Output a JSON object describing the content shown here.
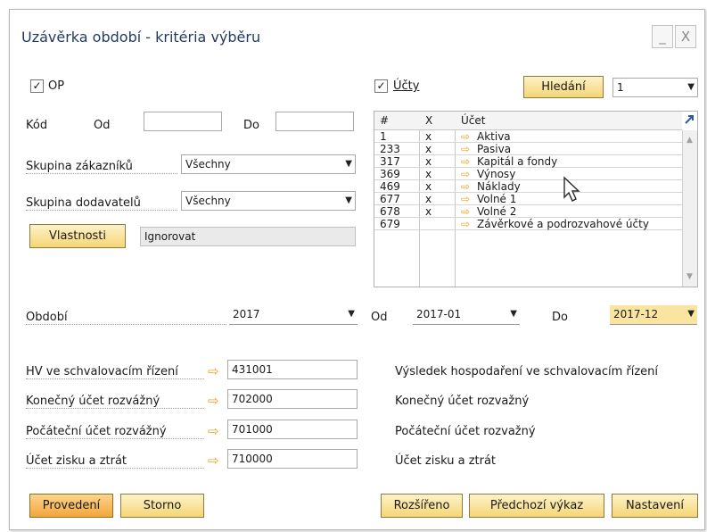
{
  "window": {
    "title": "Uzávěrka období - kritéria výběru",
    "min_glyph": "_",
    "close_glyph": "X"
  },
  "op": {
    "checked": true,
    "label": "OP"
  },
  "ucty": {
    "checked": true,
    "label": "Účty"
  },
  "search": {
    "button_label": "Hledání",
    "value": "1"
  },
  "code": {
    "label": "Kód",
    "from_label": "Od",
    "to_label": "Do",
    "from_value": "",
    "to_value": ""
  },
  "customer_group": {
    "label": "Skupina zákazníků",
    "value": "Všechny"
  },
  "vendor_group": {
    "label": "Skupina dodavatelů",
    "value": "Všechny"
  },
  "properties": {
    "button_label": "Vlastnosti",
    "value": "Ignorovat"
  },
  "grid": {
    "headers": [
      "#",
      "X",
      "Účet"
    ],
    "rows": [
      {
        "num": "1",
        "x": "x",
        "account": "Aktiva"
      },
      {
        "num": "233",
        "x": "x",
        "account": "Pasiva"
      },
      {
        "num": "317",
        "x": "x",
        "account": "Kapitál a fondy"
      },
      {
        "num": "369",
        "x": "x",
        "account": "Výnosy"
      },
      {
        "num": "469",
        "x": "x",
        "account": "Náklady"
      },
      {
        "num": "677",
        "x": "x",
        "account": "Volné 1"
      },
      {
        "num": "678",
        "x": "x",
        "account": "Volné 2"
      },
      {
        "num": "679",
        "x": "",
        "account": "Závěrkové a podrozvahové účty"
      }
    ]
  },
  "period": {
    "label": "Období",
    "value": "2017",
    "from_label": "Od",
    "from_value": "2017-01",
    "to_label": "Do",
    "to_value": "2017-12"
  },
  "accounts": [
    {
      "label": "HV ve schvalovacím řízení",
      "value": "431001",
      "description": "Výsledek hospodaření ve schvalovacím řízení"
    },
    {
      "label": "Konečný účet rozvážný",
      "value": "702000",
      "description": "Konečný účet rozvažný"
    },
    {
      "label": "Počáteční účet rozvážný",
      "value": "701000",
      "description": "Počáteční účet rozvažný"
    },
    {
      "label": "Účet zisku a ztrát",
      "value": "710000",
      "description": "Účet zisku a ztrát"
    }
  ],
  "footer": {
    "execute": "Provedení",
    "cancel": "Storno",
    "extended": "Rozšířeno",
    "previous_report": "Předchozí výkaz",
    "settings": "Nastavení"
  },
  "colors": {
    "title": "#233a63",
    "button_fill": "#f5d676",
    "primary_button_fill": "#f3a63a",
    "arrow": "#f1a11f",
    "period_to_fill": "#fbe4a0"
  }
}
